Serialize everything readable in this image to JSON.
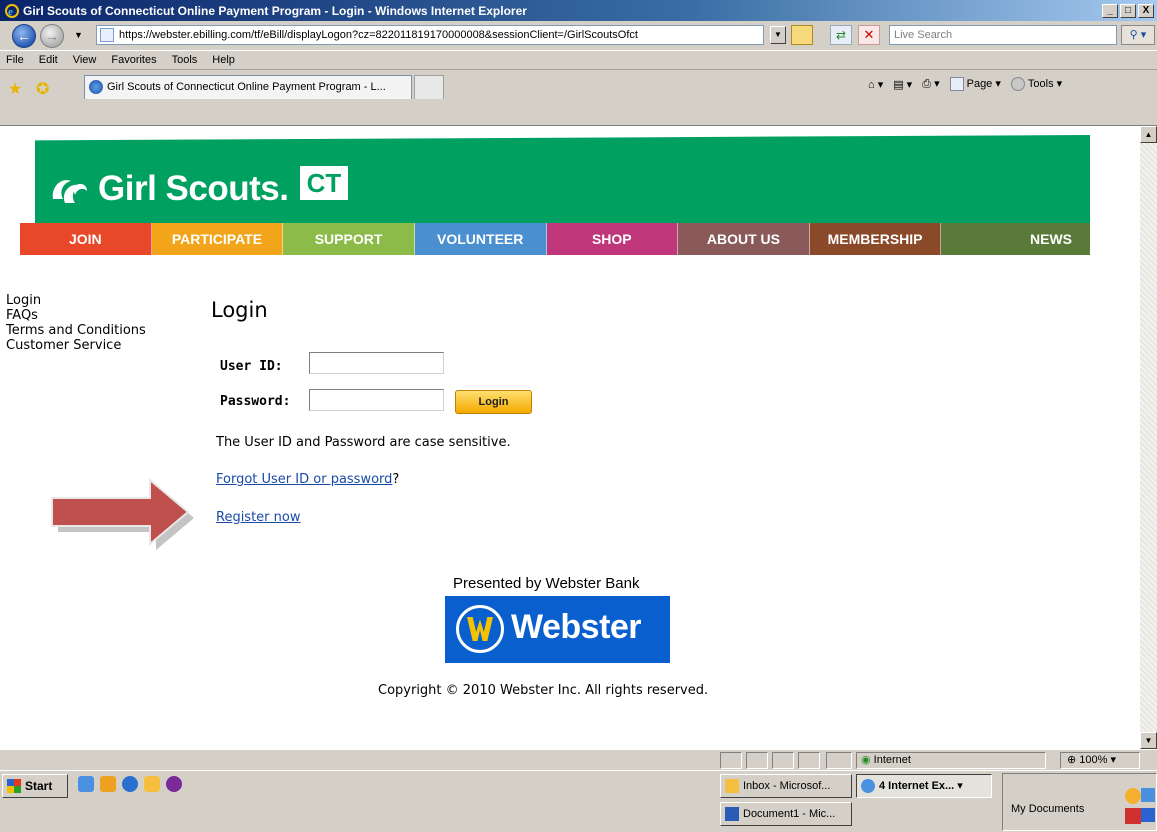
{
  "window": {
    "title": "Girl Scouts of Connecticut Online Payment Program - Login - Windows Internet Explorer",
    "controls": [
      "_",
      "□",
      "X"
    ]
  },
  "browser": {
    "address": "https://webster.ebilling.com/tf/eBill/displayLogon?cz=822011819170000008&sessionClient=/GirlScoutsOfct",
    "search_placeholder": "Live Search",
    "menu": [
      "File",
      "Edit",
      "View",
      "Favorites",
      "Tools",
      "Help"
    ],
    "tab_title": "Girl Scouts of Connecticut Online Payment Program - L...",
    "commands": [
      "Page",
      "Tools"
    ]
  },
  "site": {
    "brand": "Girl Scouts.",
    "brand_badge": "CT",
    "nav": [
      {
        "label": "JOIN",
        "color": "#e8472a"
      },
      {
        "label": "PARTICIPATE",
        "color": "#f2a51a"
      },
      {
        "label": "SUPPORT",
        "color": "#8cbb4a"
      },
      {
        "label": "VOLUNTEER",
        "color": "#4a8fcf"
      },
      {
        "label": "SHOP",
        "color": "#c0367a"
      },
      {
        "label": "ABOUT US",
        "color": "#8a5a5a"
      },
      {
        "label": "MEMBERSHIP",
        "color": "#8a4a2a"
      },
      {
        "label": "NEWS",
        "color": "#5a7a3a"
      }
    ],
    "banner_color": "#00a160"
  },
  "sidebar": {
    "links": [
      "Login",
      "FAQs",
      "Terms and Conditions",
      "Customer Service"
    ]
  },
  "login": {
    "title": "Login",
    "user_id_label": "User ID:",
    "password_label": "Password:",
    "button": "Login",
    "case_note": "The User ID and Password are case sensitive.",
    "forgot_link": "Forgot User ID or password",
    "forgot_suffix": "?",
    "register_link": "Register now"
  },
  "footer": {
    "presented_by": "Presented by Webster Bank",
    "logo_word": "Webster",
    "copyright": "Copyright © 2010 Webster Inc. All rights reserved."
  },
  "statusbar": {
    "zone": "Internet",
    "zoom": "100%"
  },
  "taskbar": {
    "start": "Start",
    "tasks": [
      {
        "label": "Inbox - Microsof..."
      },
      {
        "label": "4 Internet Ex..."
      },
      {
        "label": "Document1 - Mic..."
      }
    ],
    "tray_label": "My Documents"
  }
}
